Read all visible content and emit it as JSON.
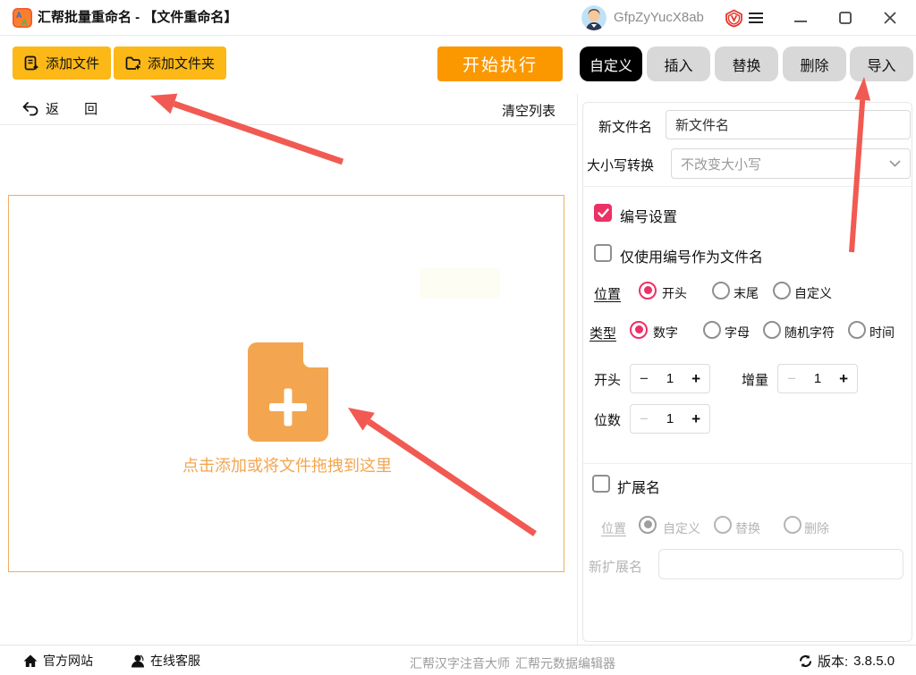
{
  "window": {
    "title": "汇帮批量重命名 - 【文件重命名】",
    "username": "GfpZyYucX8ab"
  },
  "toolbar": {
    "add_file": "添加文件",
    "add_folder": "添加文件夹",
    "start": "开始执行"
  },
  "tabs": [
    {
      "label": "自定义",
      "active": true
    },
    {
      "label": "插入",
      "active": false
    },
    {
      "label": "替换",
      "active": false
    },
    {
      "label": "删除",
      "active": false
    },
    {
      "label": "导入",
      "active": false
    }
  ],
  "list": {
    "back": "返 回",
    "clear": "清空列表"
  },
  "dropzone": {
    "hint": "点击添加或将文件拖拽到这里"
  },
  "form": {
    "new_name_label": "新文件名",
    "new_name_value": "新文件名",
    "case_label": "大小写转换",
    "case_value": "不改变大小写",
    "numbering_label": "编号设置",
    "only_number_label": "仅使用编号作为文件名",
    "position_label": "位置",
    "position_options": [
      "开头",
      "末尾",
      "自定义"
    ],
    "position_selected": "开头",
    "type_label": "类型",
    "type_options": [
      "数字",
      "字母",
      "随机字符",
      "时间"
    ],
    "type_selected": "数字",
    "start_label": "开头",
    "start_value": "1",
    "increment_label": "增量",
    "increment_value": "1",
    "digits_label": "位数",
    "digits_value": "1",
    "extension_label": "扩展名",
    "ext_position_label": "位置",
    "ext_position_options": [
      "自定义",
      "替换",
      "删除"
    ],
    "ext_position_selected": "自定义",
    "new_ext_label": "新扩展名",
    "new_ext_value": ""
  },
  "statusbar": {
    "site": "官方网站",
    "support": "在线客服",
    "link1": "汇帮汉字注音大师",
    "link2": "汇帮元数据编辑器",
    "version_label": "版本:",
    "version": "3.8.5.0"
  },
  "ui": {
    "minus": "−",
    "plus": "+"
  },
  "colors": {
    "accent_yellow": "#fbb817",
    "accent_orange": "#fb9800",
    "accent_pink": "#eb3166",
    "drop_orange": "#f3a64f",
    "arrow_red": "#f15a52",
    "tab_inactive": "#d8d8d8",
    "tab_active": "#000000"
  }
}
